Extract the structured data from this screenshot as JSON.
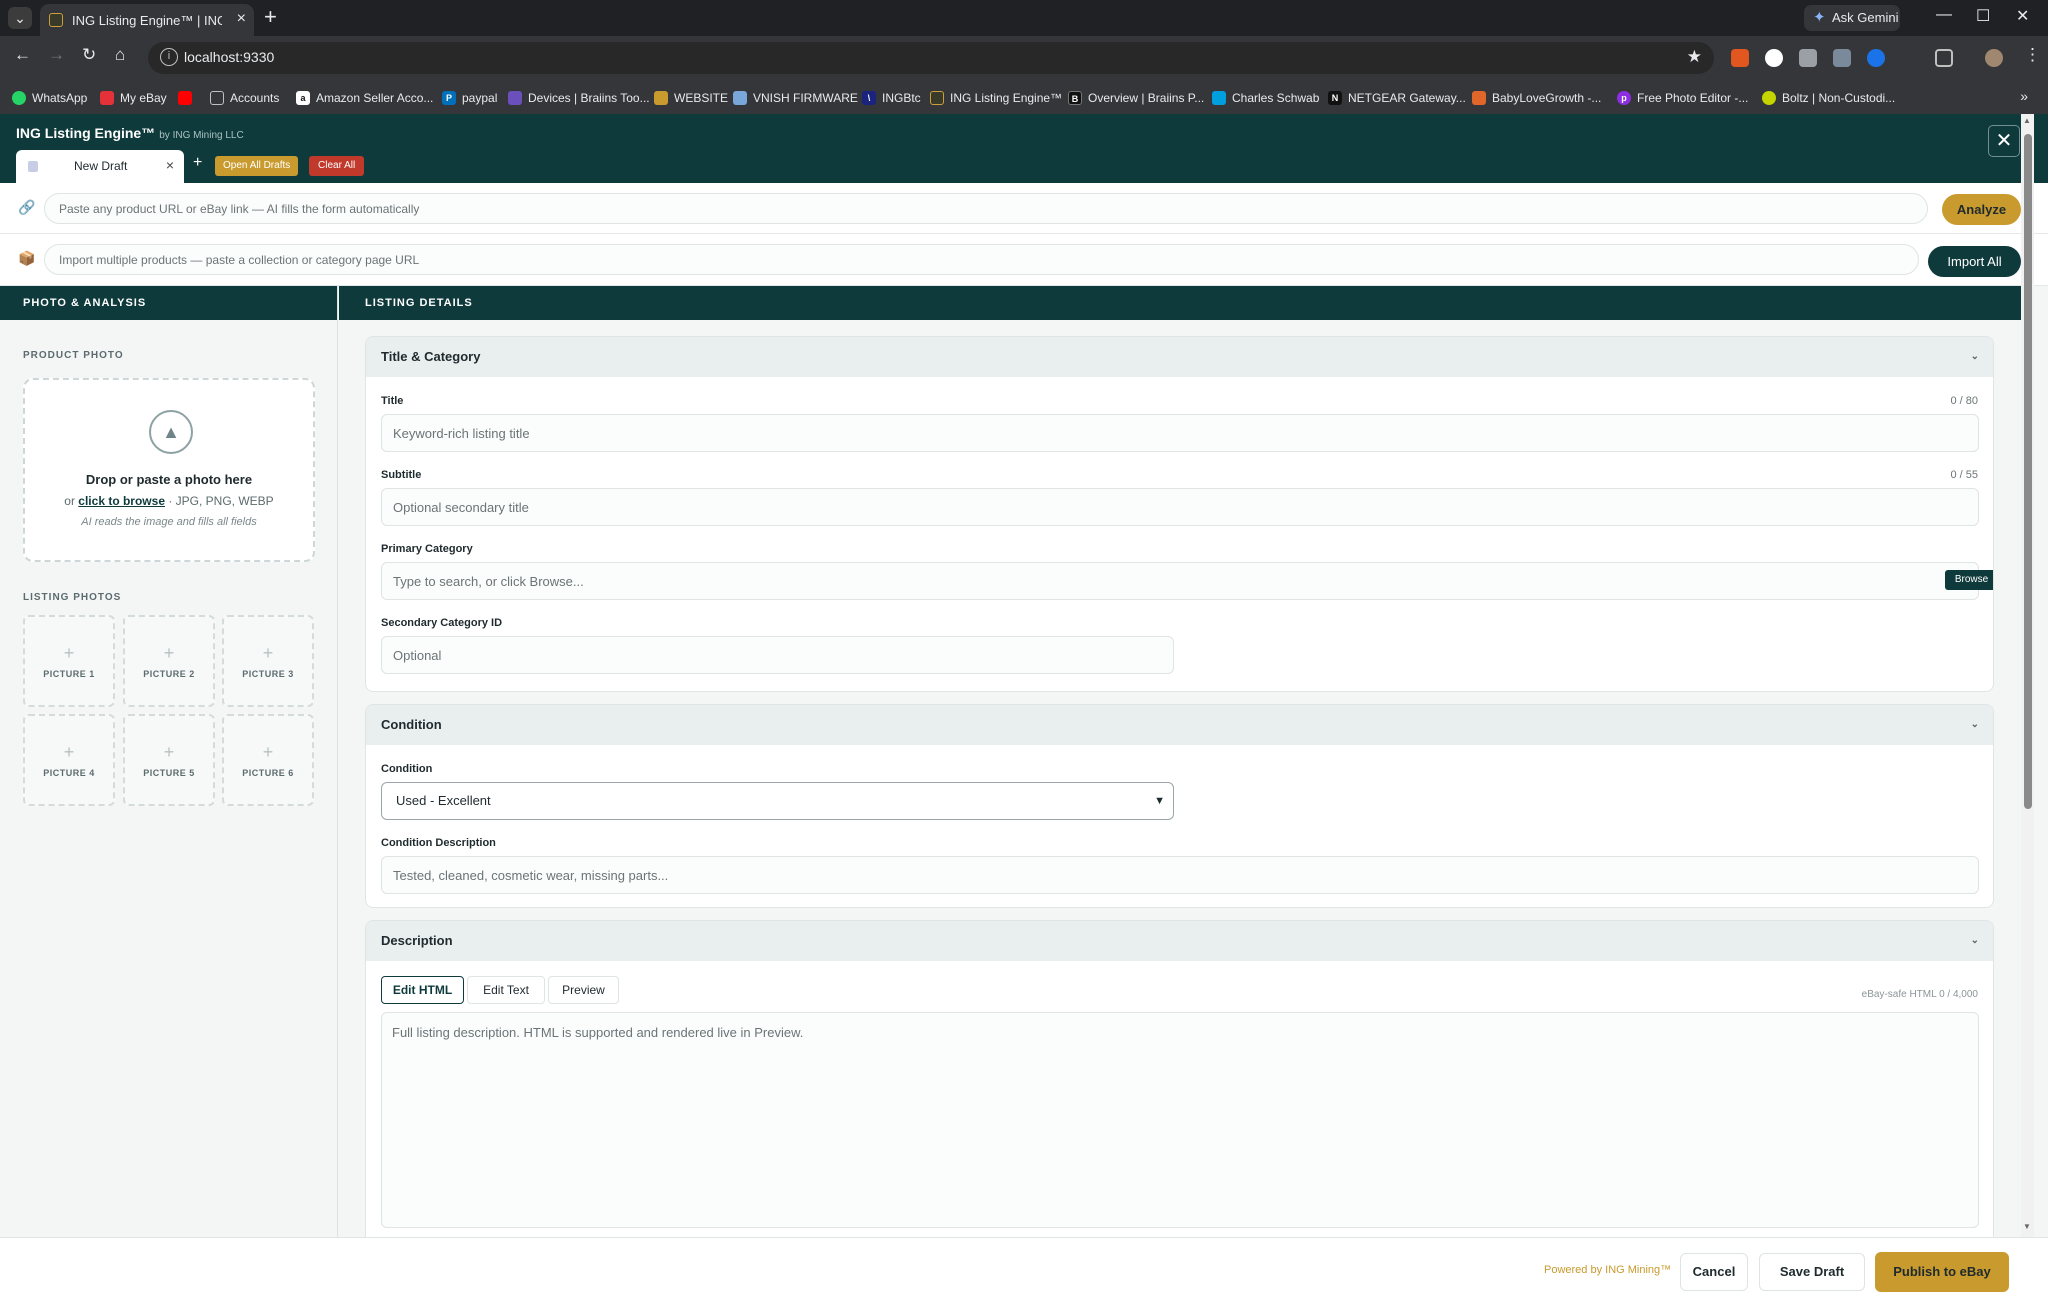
{
  "browser": {
    "tab_title": "ING Listing Engine™ | ING Mini",
    "gemini_label": "Ask Gemini",
    "url": "localhost:9330",
    "bookmarks": [
      {
        "label": "WhatsApp",
        "color": "#25d366"
      },
      {
        "label": "My eBay",
        "color": "#e53238"
      },
      {
        "label": "",
        "color": "#ff0000"
      },
      {
        "label": "Accounts",
        "color": "#9aa0a6"
      },
      {
        "label": "Amazon Seller Acco...",
        "color": "#222222"
      },
      {
        "label": "paypal",
        "color": "#0070ba"
      },
      {
        "label": "Devices | Braiins Too...",
        "color": "#6b4fbb"
      },
      {
        "label": "WEBSITE",
        "color": "#c99a2e"
      },
      {
        "label": "VNISH FIRMWARE",
        "color": "#7aa7d9"
      },
      {
        "label": "INGBtc",
        "color": "#1a237e"
      },
      {
        "label": "ING Listing Engine™",
        "color": "#caa03a"
      },
      {
        "label": "Overview | Braiins P...",
        "color": "#111111"
      },
      {
        "label": "Charles Schwab",
        "color": "#00a0df"
      },
      {
        "label": "NETGEAR Gateway...",
        "color": "#111111"
      },
      {
        "label": "BabyLoveGrowth -...",
        "color": "#e0662a"
      },
      {
        "label": "Free Photo Editor -...",
        "color": "#8e2de2"
      },
      {
        "label": "Boltz | Non-Custodi...",
        "color": "#c5d400"
      }
    ]
  },
  "app": {
    "brand": "ING Listing Engine™",
    "brand_sub": "by ING Mining LLC",
    "draft_tab": "New Draft",
    "open_all": "Open All Drafts",
    "clear_all": "Clear All",
    "analyze_placeholder": "Paste any product URL or eBay link — AI fills the form automatically",
    "analyze_button": "Analyze",
    "import_placeholder": "Import multiple products — paste a collection or category page URL",
    "import_button": "Import All"
  },
  "left": {
    "header": "PHOTO & ANALYSIS",
    "product_photo_label": "PRODUCT PHOTO",
    "drop_title": "Drop or paste a photo here",
    "drop_or": "or",
    "drop_link": "click to browse",
    "drop_formats": "· JPG, PNG, WEBP",
    "drop_hint": "AI reads the image and fills all fields",
    "listing_photos_label": "LISTING PHOTOS",
    "pictures": [
      "PICTURE 1",
      "PICTURE 2",
      "PICTURE 3",
      "PICTURE 4",
      "PICTURE 5",
      "PICTURE 6"
    ]
  },
  "right": {
    "header": "LISTING DETAILS",
    "title_card": {
      "heading": "Title & Category",
      "title_label": "Title",
      "title_count": "0 / 80",
      "title_placeholder": "Keyword-rich listing title",
      "subtitle_label": "Subtitle",
      "subtitle_count": "0 / 55",
      "subtitle_placeholder": "Optional secondary title",
      "primary_label": "Primary Category",
      "primary_placeholder": "Type to search, or click Browse...",
      "browse": "Browse",
      "secondary_label": "Secondary Category ID",
      "secondary_placeholder": "Optional"
    },
    "condition_card": {
      "heading": "Condition",
      "condition_label": "Condition",
      "condition_value": "Used - Excellent",
      "desc_label": "Condition Description",
      "desc_placeholder": "Tested, cleaned, cosmetic wear, missing parts..."
    },
    "description_card": {
      "heading": "Description",
      "tabs": [
        "Edit HTML",
        "Edit Text",
        "Preview"
      ],
      "meta": "eBay-safe HTML  0 / 4,000",
      "placeholder": "Full listing description. HTML is supported and rendered live in Preview."
    }
  },
  "footer": {
    "powered": "Powered by ING Mining™",
    "cancel": "Cancel",
    "save": "Save Draft",
    "publish": "Publish to eBay"
  }
}
